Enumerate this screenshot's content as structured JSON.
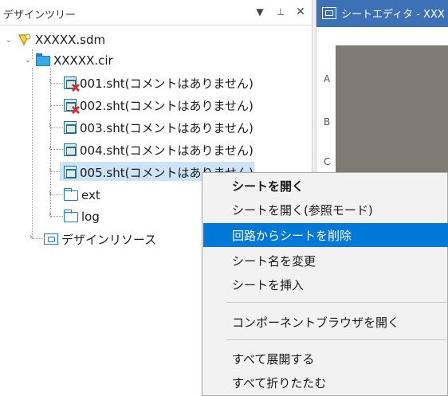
{
  "pane": {
    "title": "デザインツリー",
    "dropdown_icon": "▼",
    "pin_icon": "⊥",
    "close_icon": "✕"
  },
  "tree": {
    "root": "XXXXX.sdm",
    "circuit": "XXXXX.cir",
    "sheets": [
      "001.sht(コメントはありません)",
      "002.sht(コメントはありません)",
      "003.sht(コメントはありません)",
      "004.sht(コメントはありません)",
      "005.sht(コメントはありません)"
    ],
    "folders": [
      "ext",
      "log"
    ],
    "resources": "デザインリソース"
  },
  "editor": {
    "tab_label": "シートエディタ - XXX",
    "row_letters": [
      "A",
      "B",
      "C"
    ]
  },
  "context_menu": {
    "items": [
      "シートを開く",
      "シートを開く(参照モード)",
      "回路からシートを削除",
      "シート名を変更",
      "シートを挿入",
      "コンポーネントブラウザを開く",
      "すべて展開する",
      "すべて折りたたむ"
    ],
    "highlighted_index": 2
  }
}
